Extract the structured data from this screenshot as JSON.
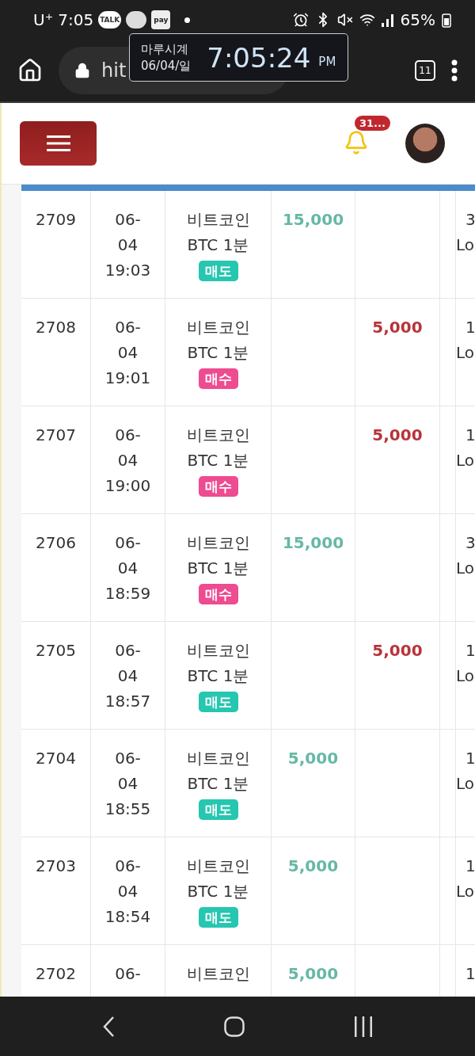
{
  "status_bar": {
    "carrier": "U⁺",
    "time": "7:05",
    "talk_icon_label": "TALK",
    "pay_icon_label": "pay",
    "battery": "65%"
  },
  "browser": {
    "url": "hit",
    "tab_count": "11"
  },
  "clock_overlay": {
    "app_name": "마루시계",
    "date": "06/04/일",
    "time": "7:05:24",
    "period": "PM"
  },
  "header": {
    "notification_count": "31..."
  },
  "table": {
    "rows": [
      {
        "id": "2709",
        "date_lines": [
          "06-",
          "04",
          "19:03"
        ],
        "name": "비트코인",
        "product": "BTC 1분",
        "side": {
          "label": "매도",
          "kind": "sell"
        },
        "profit": "15,000",
        "column_7": [
          "3",
          "Lo"
        ]
      },
      {
        "id": "2708",
        "date_lines": [
          "06-",
          "04",
          "19:01"
        ],
        "name": "비트코인",
        "product": "BTC 1분",
        "side": {
          "label": "매수",
          "kind": "buy"
        },
        "loss": "5,000",
        "column_7": [
          "1",
          "Lo"
        ]
      },
      {
        "id": "2707",
        "date_lines": [
          "06-",
          "04",
          "19:00"
        ],
        "name": "비트코인",
        "product": "BTC 1분",
        "side": {
          "label": "매수",
          "kind": "buy"
        },
        "loss": "5,000",
        "column_7": [
          "1",
          "Lo"
        ]
      },
      {
        "id": "2706",
        "date_lines": [
          "06-",
          "04",
          "18:59"
        ],
        "name": "비트코인",
        "product": "BTC 1분",
        "side": {
          "label": "매수",
          "kind": "buy"
        },
        "profit": "15,000",
        "column_7": [
          "3",
          "Lo"
        ]
      },
      {
        "id": "2705",
        "date_lines": [
          "06-",
          "04",
          "18:57"
        ],
        "name": "비트코인",
        "product": "BTC 1분",
        "side": {
          "label": "매도",
          "kind": "sell"
        },
        "loss": "5,000",
        "column_7": [
          "1",
          "Lo"
        ]
      },
      {
        "id": "2704",
        "date_lines": [
          "06-",
          "04",
          "18:55"
        ],
        "name": "비트코인",
        "product": "BTC 1분",
        "side": {
          "label": "매도",
          "kind": "sell"
        },
        "profit": "5,000",
        "column_7": [
          "1",
          "Lo"
        ]
      },
      {
        "id": "2703",
        "date_lines": [
          "06-",
          "04",
          "18:54"
        ],
        "name": "비트코인",
        "product": "BTC 1분",
        "side": {
          "label": "매도",
          "kind": "sell"
        },
        "profit": "5,000",
        "column_7": [
          "1",
          "Lo"
        ]
      },
      {
        "id": "2702",
        "date_lines": [
          "06-"
        ],
        "name": "비트코인",
        "profit": "5,000",
        "column_7": [
          "1"
        ]
      }
    ]
  }
}
